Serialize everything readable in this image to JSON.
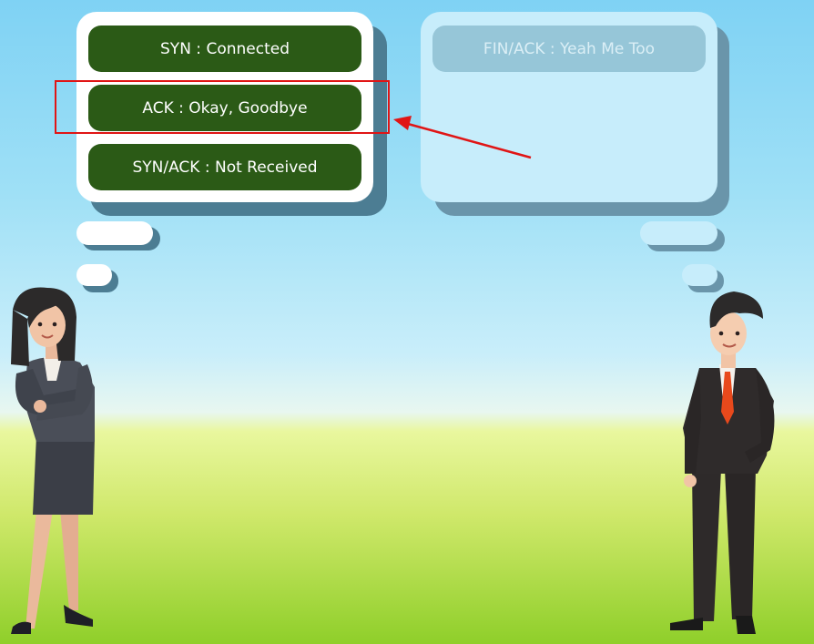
{
  "options": {
    "syn": "SYN : Connected",
    "ack": "ACK : Okay, Goodbye",
    "synack": "SYN/ACK : Not Received"
  },
  "received_message": "FIN/ACK : Yeah Me Too",
  "colors": {
    "answer_button": "#2b5a16",
    "highlight": "#e01515",
    "sky": "#7fd2f4",
    "grass": "#8fcf2a"
  },
  "icons": [
    "woman-character",
    "man-character",
    "arrow"
  ]
}
